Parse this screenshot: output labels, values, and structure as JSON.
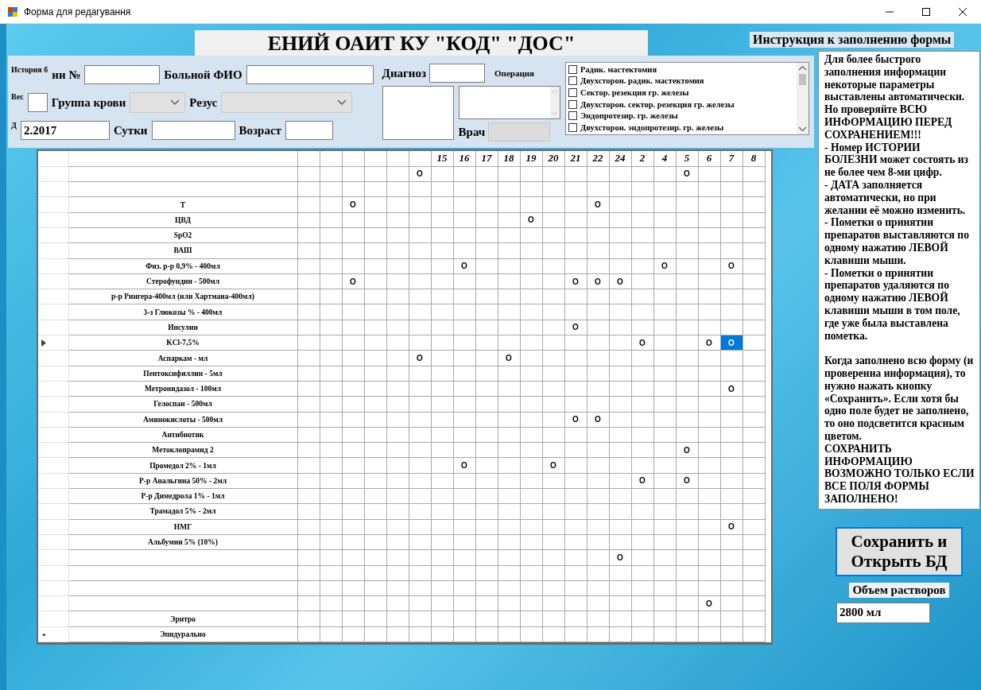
{
  "window": {
    "title": "Форма для редагування"
  },
  "header_title": "ЕНИЙ ОАИТ КУ \"КОД\" \"ДОС\"",
  "form": {
    "history": {
      "hint": "История б",
      "label": "ни №"
    },
    "patient": {
      "label": "Больной ФИО"
    },
    "weight": {
      "hint": "Вес"
    },
    "blood_group": {
      "label": "Группа крови",
      "disabled": true
    },
    "rhesus": {
      "label": "Резус",
      "disabled": true
    },
    "date": {
      "hint": "Д",
      "value": "2.2017"
    },
    "days": {
      "label": "Сутки"
    },
    "age": {
      "label": "Возраст"
    },
    "diagnosis": {
      "label": "Диагноз"
    },
    "operation": {
      "label": "Операция"
    },
    "doctor": {
      "label": "Врач",
      "disabled": true
    }
  },
  "operations": [
    {
      "label": "Радик. мастектомия",
      "checked": false
    },
    {
      "label": "Двухсторон. радик. мастектомия",
      "checked": false
    },
    {
      "label": "Сектор. резекция гр. железы",
      "checked": false
    },
    {
      "label": "Двухсторон. сектор. резекция гр. железы",
      "checked": false
    },
    {
      "label": "Эндопротезир. гр. железы",
      "checked": false
    },
    {
      "label": "Двухсторон. эндопротезир. гр. железы",
      "checked": false
    }
  ],
  "grid": {
    "columns": [
      {},
      {},
      {},
      {},
      {},
      {},
      {
        "label": "15"
      },
      {
        "label": "16"
      },
      {
        "label": "17"
      },
      {
        "label": "18"
      },
      {
        "label": "19"
      },
      {
        "label": "20"
      },
      {
        "label": "21"
      },
      {
        "label": "22"
      },
      {
        "label": "24"
      },
      {
        "label": "2"
      },
      {
        "label": "4"
      },
      {
        "label": "5"
      },
      {
        "label": "6"
      },
      {
        "label": "7"
      },
      {
        "label": "8"
      }
    ],
    "rows": [
      {
        "current": false,
        "cells": [
          null,
          null,
          null,
          null,
          null,
          {
            "text": "O",
            "selected": false
          },
          null,
          null,
          null,
          null,
          null,
          null,
          null,
          null,
          null,
          null,
          null,
          {
            "text": "O",
            "selected": false
          },
          null,
          null,
          null
        ]
      },
      {
        "current": false,
        "cells": [
          null,
          null,
          null,
          null,
          null,
          null,
          null,
          null,
          null,
          null,
          null,
          null,
          null,
          null,
          null,
          null,
          null,
          null,
          null,
          null,
          null
        ]
      },
      {
        "name": "Т",
        "current": false,
        "cells": [
          null,
          null,
          {
            "text": "O",
            "selected": false
          },
          null,
          null,
          null,
          null,
          null,
          null,
          null,
          null,
          null,
          null,
          {
            "text": "O",
            "selected": false
          },
          null,
          null,
          null,
          null,
          null,
          null,
          null
        ]
      },
      {
        "name": "ЦВД",
        "current": false,
        "cells": [
          null,
          null,
          null,
          null,
          null,
          null,
          null,
          null,
          null,
          null,
          {
            "text": "O",
            "selected": false
          },
          null,
          null,
          null,
          null,
          null,
          null,
          null,
          null,
          null,
          null
        ]
      },
      {
        "name": "SpO2",
        "current": false,
        "cells": [
          null,
          null,
          null,
          null,
          null,
          null,
          null,
          null,
          null,
          null,
          null,
          null,
          null,
          null,
          null,
          null,
          null,
          null,
          null,
          null,
          null
        ]
      },
      {
        "name": "ВАШ",
        "current": false,
        "cells": [
          null,
          null,
          null,
          null,
          null,
          null,
          null,
          null,
          null,
          null,
          null,
          null,
          null,
          null,
          null,
          null,
          null,
          null,
          null,
          null,
          null
        ]
      },
      {
        "name": "Физ. р-р 0,9% - 400мл",
        "current": false,
        "cells": [
          null,
          null,
          null,
          null,
          null,
          null,
          null,
          {
            "text": "O",
            "selected": false
          },
          null,
          null,
          null,
          null,
          null,
          null,
          null,
          null,
          {
            "text": "O",
            "selected": false
          },
          null,
          null,
          {
            "text": "O",
            "selected": false
          },
          null
        ]
      },
      {
        "name": "Стерофундин - 500мл",
        "current": false,
        "cells": [
          null,
          null,
          {
            "text": "O",
            "selected": false
          },
          null,
          null,
          null,
          null,
          null,
          null,
          null,
          null,
          null,
          {
            "text": "O",
            "selected": false
          },
          {
            "text": "O",
            "selected": false
          },
          {
            "text": "O",
            "selected": false
          },
          null,
          null,
          null,
          null,
          null,
          null
        ]
      },
      {
        "name": "р-р Рингера-400мл (или Хартмана-400мл)",
        "current": false,
        "cells": [
          null,
          null,
          null,
          null,
          null,
          null,
          null,
          null,
          null,
          null,
          null,
          null,
          null,
          null,
          null,
          null,
          null,
          null,
          null,
          null,
          null
        ]
      },
      {
        "name": "3-з Глюкозы % - 400мл",
        "current": false,
        "cells": [
          null,
          null,
          null,
          null,
          null,
          null,
          null,
          null,
          null,
          null,
          null,
          null,
          null,
          null,
          null,
          null,
          null,
          null,
          null,
          null,
          null
        ]
      },
      {
        "name": "Инсулин",
        "current": false,
        "cells": [
          null,
          null,
          null,
          null,
          null,
          null,
          null,
          null,
          null,
          null,
          null,
          null,
          {
            "text": "O",
            "selected": false
          },
          null,
          null,
          null,
          null,
          null,
          null,
          null,
          null
        ]
      },
      {
        "name": "KCl-7,5%",
        "current": true,
        "cells": [
          null,
          null,
          null,
          null,
          null,
          null,
          null,
          null,
          null,
          null,
          null,
          null,
          null,
          null,
          null,
          {
            "text": "O",
            "selected": false
          },
          null,
          null,
          {
            "text": "O",
            "selected": false
          },
          {
            "text": "O",
            "selected": true
          },
          null
        ]
      },
      {
        "name": "Аспаркам - мл",
        "current": false,
        "cells": [
          null,
          null,
          null,
          null,
          null,
          {
            "text": "O",
            "selected": false
          },
          null,
          null,
          null,
          {
            "text": "O",
            "selected": false
          },
          null,
          null,
          null,
          null,
          null,
          null,
          null,
          null,
          null,
          null,
          null
        ]
      },
      {
        "name": "Пентоксифиллин - 5мл",
        "current": false,
        "cells": [
          null,
          null,
          null,
          null,
          null,
          null,
          null,
          null,
          null,
          null,
          null,
          null,
          null,
          null,
          null,
          null,
          null,
          null,
          null,
          null,
          null
        ]
      },
      {
        "name": "Метронидазол - 100мл",
        "current": false,
        "cells": [
          null,
          null,
          null,
          null,
          null,
          null,
          null,
          null,
          null,
          null,
          null,
          null,
          null,
          null,
          null,
          null,
          null,
          null,
          null,
          {
            "text": "O",
            "selected": false
          },
          null
        ]
      },
      {
        "name": "Гелоспан - 500мл",
        "current": false,
        "cells": [
          null,
          null,
          null,
          null,
          null,
          null,
          null,
          null,
          null,
          null,
          null,
          null,
          null,
          null,
          null,
          null,
          null,
          null,
          null,
          null,
          null
        ]
      },
      {
        "name": "Аминокислоты - 500мл",
        "current": false,
        "cells": [
          null,
          null,
          null,
          null,
          null,
          null,
          null,
          null,
          null,
          null,
          null,
          null,
          {
            "text": "O",
            "selected": false
          },
          {
            "text": "O",
            "selected": false
          },
          null,
          null,
          null,
          null,
          null,
          null,
          null
        ]
      },
      {
        "name": "Антибиотик",
        "current": false,
        "cells": [
          null,
          null,
          null,
          null,
          null,
          null,
          null,
          null,
          null,
          null,
          null,
          null,
          null,
          null,
          null,
          null,
          null,
          null,
          null,
          null,
          null
        ]
      },
      {
        "name": "Метоклопрамид 2",
        "current": false,
        "cells": [
          null,
          null,
          null,
          null,
          null,
          null,
          null,
          null,
          null,
          null,
          null,
          null,
          null,
          null,
          null,
          null,
          null,
          {
            "text": "O",
            "selected": false
          },
          null,
          null,
          null
        ]
      },
      {
        "name": "Промедол 2% - 1мл",
        "current": false,
        "cells": [
          null,
          null,
          null,
          null,
          null,
          null,
          null,
          {
            "text": "O",
            "selected": false
          },
          null,
          null,
          null,
          {
            "text": "O",
            "selected": false
          },
          null,
          null,
          null,
          null,
          null,
          null,
          null,
          null,
          null
        ]
      },
      {
        "name": "Р-р Анальгина 50% - 2мл",
        "current": false,
        "cells": [
          null,
          null,
          null,
          null,
          null,
          null,
          null,
          null,
          null,
          null,
          null,
          null,
          null,
          null,
          null,
          {
            "text": "O",
            "selected": false
          },
          null,
          {
            "text": "O",
            "selected": false
          },
          null,
          null,
          null
        ]
      },
      {
        "name": "Р-р Димедрола 1% - 1мл",
        "current": false,
        "cells": [
          null,
          null,
          null,
          null,
          null,
          null,
          null,
          null,
          null,
          null,
          null,
          null,
          null,
          null,
          null,
          null,
          null,
          null,
          null,
          null,
          null
        ]
      },
      {
        "name": "Трамадол 5% - 2мл",
        "current": false,
        "cells": [
          null,
          null,
          null,
          null,
          null,
          null,
          null,
          null,
          null,
          null,
          null,
          null,
          null,
          null,
          null,
          null,
          null,
          null,
          null,
          null,
          null
        ]
      },
      {
        "name": "НМГ",
        "current": false,
        "cells": [
          null,
          null,
          null,
          null,
          null,
          null,
          null,
          null,
          null,
          null,
          null,
          null,
          null,
          null,
          null,
          null,
          null,
          null,
          null,
          {
            "text": "O",
            "selected": false
          },
          null
        ]
      },
      {
        "name": "Альбумин 5% (10%)",
        "current": false,
        "cells": [
          null,
          null,
          null,
          null,
          null,
          null,
          null,
          null,
          null,
          null,
          null,
          null,
          null,
          null,
          null,
          null,
          null,
          null,
          null,
          null,
          null
        ]
      },
      {
        "current": false,
        "cells": [
          null,
          null,
          null,
          null,
          null,
          null,
          null,
          null,
          null,
          null,
          null,
          null,
          null,
          null,
          {
            "text": "O",
            "selected": false
          },
          null,
          null,
          null,
          null,
          null,
          null
        ]
      },
      {
        "current": false,
        "cells": [
          null,
          null,
          null,
          null,
          null,
          null,
          null,
          null,
          null,
          null,
          null,
          null,
          null,
          null,
          null,
          null,
          null,
          null,
          null,
          null,
          null
        ]
      },
      {
        "current": false,
        "cells": [
          null,
          null,
          null,
          null,
          null,
          null,
          null,
          null,
          null,
          null,
          null,
          null,
          null,
          null,
          null,
          null,
          null,
          null,
          null,
          null,
          null
        ]
      },
      {
        "current": false,
        "cells": [
          null,
          null,
          null,
          null,
          null,
          null,
          null,
          null,
          null,
          null,
          null,
          null,
          null,
          null,
          null,
          null,
          null,
          null,
          {
            "text": "O",
            "selected": false
          },
          null,
          null
        ]
      },
      {
        "name": "Эритро",
        "current": false,
        "cells": [
          null,
          null,
          null,
          null,
          null,
          null,
          null,
          null,
          null,
          null,
          null,
          null,
          null,
          null,
          null,
          null,
          null,
          null,
          null,
          null,
          null
        ]
      },
      {
        "name": "Эпидурально",
        "current": false,
        "marker": "*",
        "cells": [
          null,
          null,
          null,
          null,
          null,
          null,
          null,
          null,
          null,
          null,
          null,
          null,
          null,
          null,
          null,
          null,
          null,
          null,
          null,
          null,
          null
        ]
      }
    ]
  },
  "instructions": {
    "title": "Инструкция к заполнению формы",
    "groups": [
      [
        "Для более быстрого заполнения информации некоторые параметры выставлены автоматически. Но проверяйте ВСЮ ИНФОРМАЦИЮ ПЕРЕД СОХРАНЕНИЕМ!!!",
        "- Номер ИСТОРИИ БОЛЕЗНИ может состоять из не более чем 8-ми цифр.",
        "- ДАТА заполняется автоматически, но при желании её можно изменить.",
        "- Пометки о принятии препаратов выставляются по одному нажатию ЛЕВОЙ клавиши мыши.",
        "- Пометки о принятии препаратов удаляются по одному нажатию ЛЕВОЙ клавиши мыши в том поле, где уже была выставлена пометка."
      ],
      [
        "Когда заполнено всю форму (и проверенна информация), то нужно нажать кнопку «Сохранить». Если хотя бы одно поле будет не заполнено, то оно подсветится красным цветом.",
        "СОХРАНИТЬ ИНФОРМАЦИЮ ВОЗМОЖНО ТОЛЬКО ЕСЛИ ВСЕ ПОЛЯ ФОРМЫ ЗАПОЛНЕНО!"
      ]
    ]
  },
  "save_button": "Сохранить и Открыть БД",
  "volume": {
    "label": "Объем растворов",
    "value": "2800 мл"
  }
}
